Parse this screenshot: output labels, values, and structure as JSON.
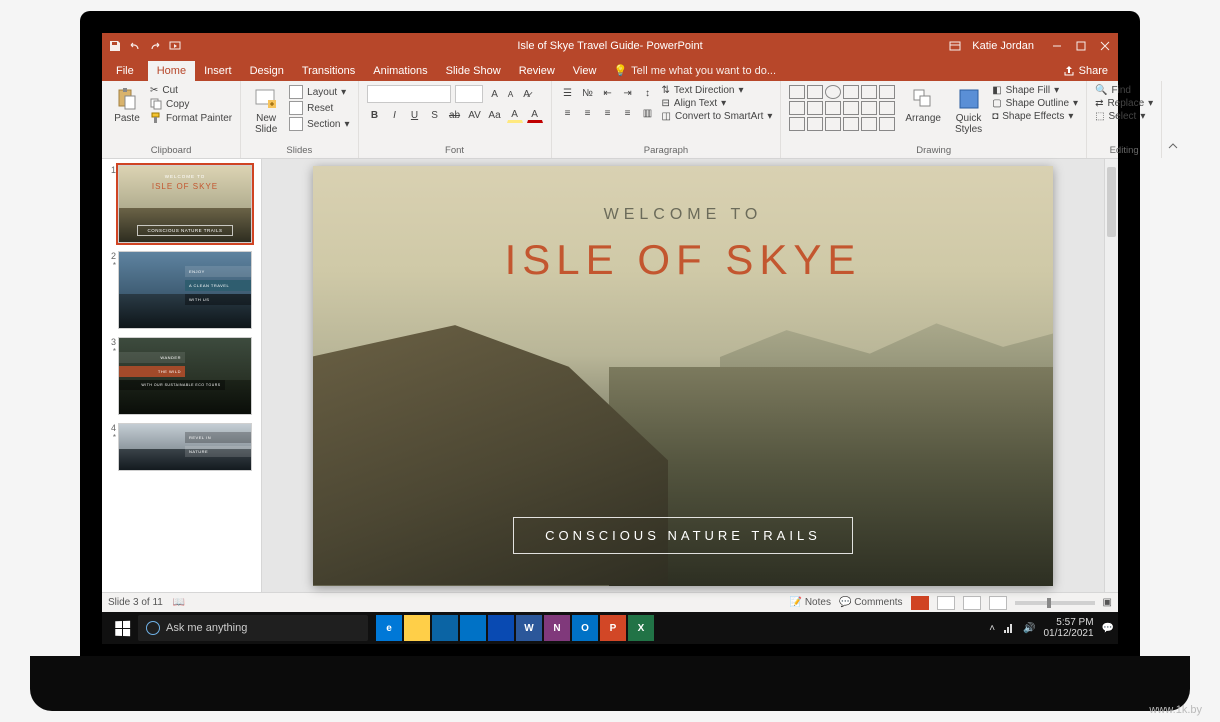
{
  "titlebar": {
    "title": "Isle of Skye Travel Guide- PowerPoint",
    "user": "Katie Jordan"
  },
  "tabs": {
    "file": "File",
    "home": "Home",
    "insert": "Insert",
    "design": "Design",
    "transitions": "Transitions",
    "animations": "Animations",
    "slideshow": "Slide Show",
    "review": "Review",
    "view": "View",
    "tellme": "Tell me what you want to do...",
    "share": "Share"
  },
  "ribbon": {
    "clipboard": {
      "label": "Clipboard",
      "paste": "Paste",
      "cut": "Cut",
      "copy": "Copy",
      "format_painter": "Format Painter"
    },
    "slides": {
      "label": "Slides",
      "new_slide": "New\nSlide",
      "layout": "Layout",
      "reset": "Reset",
      "section": "Section"
    },
    "font": {
      "label": "Font"
    },
    "paragraph": {
      "label": "Paragraph",
      "text_direction": "Text Direction",
      "align_text": "Align Text",
      "smartart": "Convert to SmartArt"
    },
    "drawing": {
      "label": "Drawing",
      "arrange": "Arrange",
      "quick_styles": "Quick\nStyles",
      "shape_fill": "Shape Fill",
      "shape_outline": "Shape Outline",
      "shape_effects": "Shape Effects"
    },
    "editing": {
      "label": "Editing",
      "find": "Find",
      "replace": "Replace",
      "select": "Select"
    }
  },
  "thumbs": {
    "items": [
      {
        "num": "1",
        "pretitle": "WELCOME TO",
        "title": "ISLE OF SKYE",
        "caption": "CONSCIOUS NATURE TRAILS"
      },
      {
        "num": "2",
        "line1": "ENJOY",
        "line2": "A CLEAN TRAVEL",
        "line3": "WITH US"
      },
      {
        "num": "3",
        "line1": "WANDER",
        "line2": "THE WILD",
        "line3": "WITH OUR SUSTAINABLE ECO TOURS"
      },
      {
        "num": "4",
        "line1": "REVEL IN",
        "line2": "NATURE"
      }
    ]
  },
  "slide": {
    "pretitle": "WELCOME TO",
    "title": "ISLE OF SKYE",
    "caption": "CONSCIOUS NATURE TRAILS"
  },
  "status": {
    "slide": "Slide 3 of 11",
    "notes": "Notes",
    "comments": "Comments"
  },
  "taskbar": {
    "search_placeholder": "Ask me anything",
    "apps": [
      {
        "name": "edge",
        "bg": "#0078d7",
        "txt": "e"
      },
      {
        "name": "file-explorer",
        "bg": "#ffcf48",
        "txt": ""
      },
      {
        "name": "store",
        "bg": "#0b64a4",
        "txt": ""
      },
      {
        "name": "mail",
        "bg": "#0072c6",
        "txt": ""
      },
      {
        "name": "onedrive",
        "bg": "#094ab2",
        "txt": ""
      },
      {
        "name": "word",
        "bg": "#2b579a",
        "txt": "W"
      },
      {
        "name": "onenote",
        "bg": "#80397b",
        "txt": "N"
      },
      {
        "name": "outlook",
        "bg": "#0072c6",
        "txt": "O"
      },
      {
        "name": "powerpoint",
        "bg": "#d24726",
        "txt": "P"
      },
      {
        "name": "excel",
        "bg": "#217346",
        "txt": "X"
      }
    ],
    "time": "5:57 PM",
    "date": "01/12/2021"
  },
  "watermark": "www.1k.by"
}
